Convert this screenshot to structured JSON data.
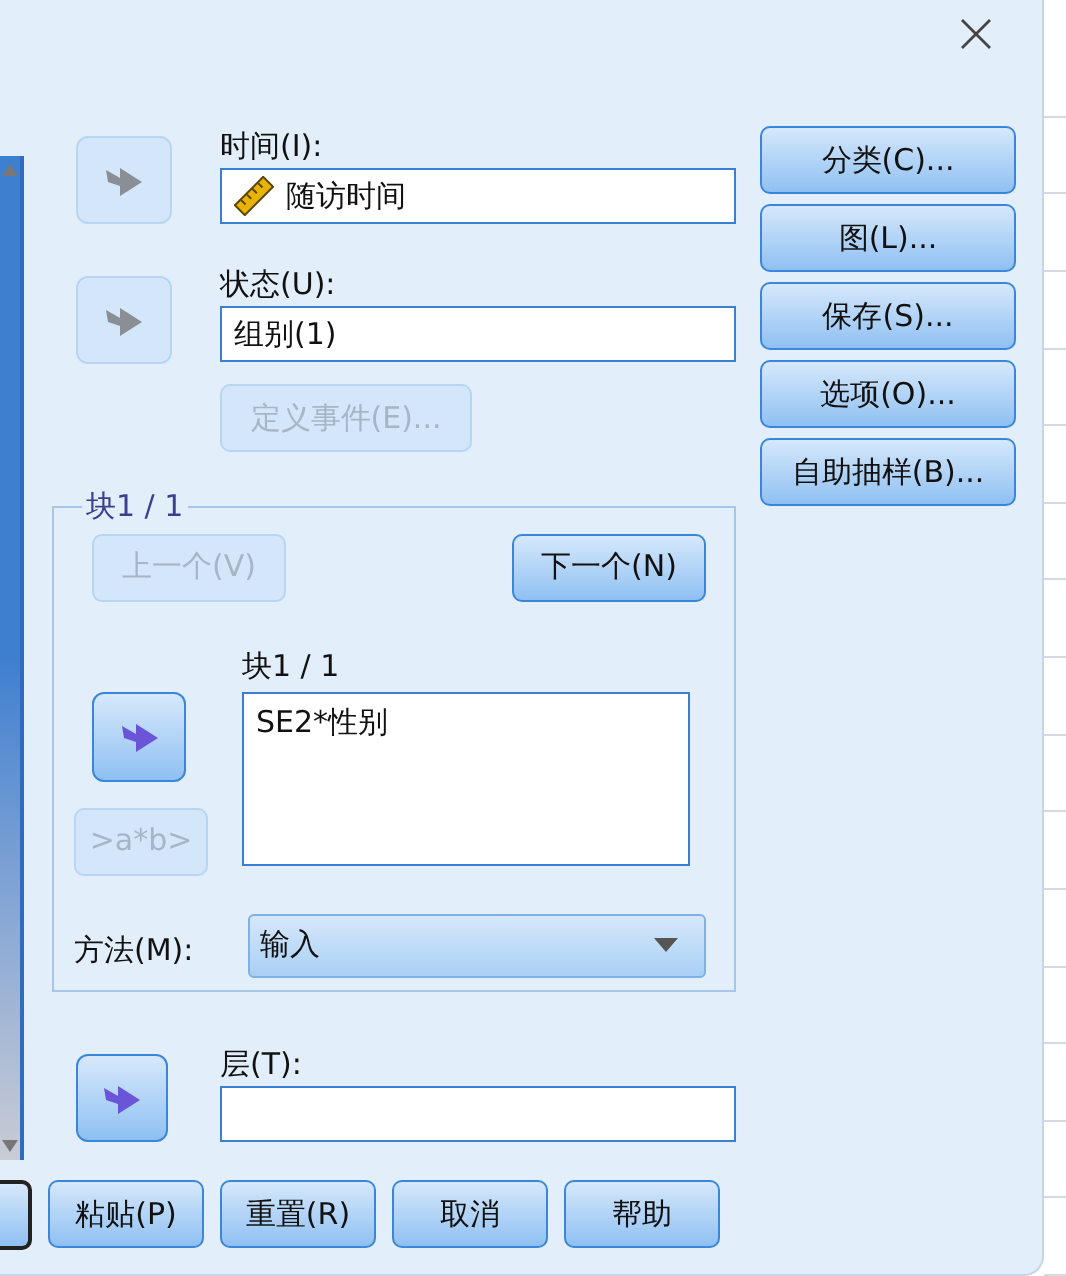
{
  "time": {
    "label": "时间(I):",
    "value": "随访时间",
    "move_disabled": true
  },
  "status": {
    "label": "状态(U):",
    "value": "组别(1)",
    "move_disabled": true
  },
  "define_event_button": {
    "label": "定义事件(E)...",
    "disabled": true
  },
  "block_group": {
    "title": "块1 / 1",
    "previous": {
      "label": "上一个(V)",
      "disabled": true
    },
    "next": {
      "label": "下一个(N)",
      "disabled": false
    },
    "list_label": "块1 / 1",
    "items": [
      "SE2*性别"
    ],
    "move_disabled": false,
    "interaction": {
      "label": ">a*b>",
      "disabled": true
    },
    "method": {
      "label": "方法(M):",
      "value": "输入"
    }
  },
  "strata": {
    "label": "层(T):",
    "move_disabled": false
  },
  "side_buttons": [
    {
      "label": "分类(C)...",
      "disabled": false
    },
    {
      "label": "图(L)...",
      "disabled": false
    },
    {
      "label": "保存(S)...",
      "disabled": false
    },
    {
      "label": "选项(O)...",
      "disabled": false
    },
    {
      "label": "自助抽样(B)...",
      "disabled": false
    }
  ],
  "bottom_buttons": [
    {
      "label": "粘贴(P)",
      "disabled": false
    },
    {
      "label": "重置(R)",
      "disabled": false
    },
    {
      "label": "取消",
      "disabled": false
    },
    {
      "label": "帮助",
      "disabled": false
    }
  ]
}
